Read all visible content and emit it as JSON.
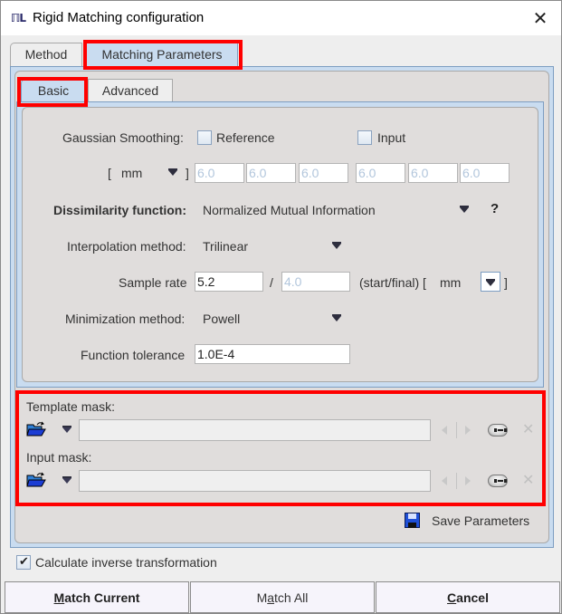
{
  "window": {
    "title": "Rigid Matching configuration",
    "app_icon": "PMOD-icon",
    "close_label": "✕"
  },
  "tabs": [
    {
      "label": "Method",
      "active": false
    },
    {
      "label": "Matching Parameters",
      "active": true
    }
  ],
  "subtabs": [
    {
      "label": "Basic",
      "active": true
    },
    {
      "label": "Advanced",
      "active": false
    }
  ],
  "basic": {
    "gaussian_smoothing": {
      "label": "Gaussian Smoothing:",
      "reference_label": "Reference",
      "reference_checked": false,
      "input_label": "Input",
      "input_checked": false,
      "unit_open": "[",
      "unit": "mm",
      "unit_close": "]",
      "values": [
        "6.0",
        "6.0",
        "6.0",
        "6.0",
        "6.0",
        "6.0"
      ]
    },
    "dissimilarity": {
      "label": "Dissimilarity function:",
      "value": "Normalized Mutual Information",
      "help": "?"
    },
    "interpolation": {
      "label": "Interpolation method:",
      "value": "Trilinear"
    },
    "sample_rate": {
      "label": "Sample rate",
      "start": "5.2",
      "separator": "/",
      "final": "4.0",
      "suffix": "(start/final) [",
      "unit": "mm",
      "close": "]"
    },
    "minimization": {
      "label": "Minimization method:",
      "value": "Powell"
    },
    "tolerance": {
      "label": "Function tolerance",
      "value": "1.0E-4"
    }
  },
  "masks": {
    "template_label": "Template mask:",
    "template_value": "",
    "input_label": "Input mask:",
    "input_value": ""
  },
  "save_parameters_label": "Save Parameters",
  "inverse": {
    "label": "Calculate inverse transformation",
    "checked": true
  },
  "buttons": {
    "match_current": {
      "mnemonic": "M",
      "rest": "atch Current"
    },
    "match_all": {
      "pre": "M",
      "mnemonic": "a",
      "rest": "tch All"
    },
    "cancel": {
      "mnemonic": "C",
      "rest": "ancel"
    }
  },
  "colors": {
    "highlight": "#ff0000",
    "tab_active": "#c9dcf0",
    "panel_bg": "#e0dddc",
    "disabled_text": "#b2c6dc"
  }
}
